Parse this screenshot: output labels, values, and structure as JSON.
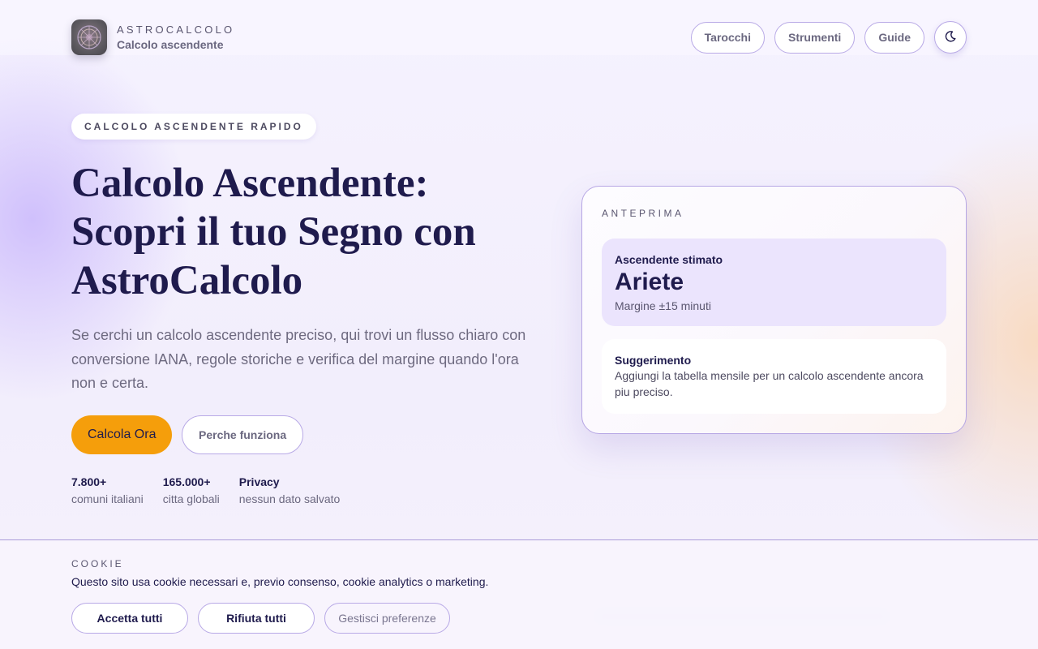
{
  "brand": {
    "name": "ASTROCALCOLO",
    "subtitle": "Calcolo ascendente",
    "logo_icon": "zodiac-wheel-icon"
  },
  "nav": {
    "items": [
      {
        "label": "Tarocchi"
      },
      {
        "label": "Strumenti"
      },
      {
        "label": "Guide"
      }
    ],
    "theme_toggle_icon": "moon-icon"
  },
  "hero": {
    "eyebrow": "CALCOLO ASCENDENTE RAPIDO",
    "title": "Calcolo Ascendente: Scopri il tuo Segno con AstroCalcolo",
    "lead": "Se cerchi un calcolo ascendente preciso, qui trovi un flusso chiaro con conversione IANA, regole storiche e verifica del margine quando l'ora non e certa.",
    "primary_cta": "Calcola Ora",
    "secondary_cta": "Perche funziona",
    "stats": [
      {
        "value": "7.800+",
        "label": "comuni italiani"
      },
      {
        "value": "165.000+",
        "label": "citta globali"
      },
      {
        "value": "Privacy",
        "label": "nessun dato salvato"
      }
    ]
  },
  "preview": {
    "eyebrow": "ANTEPRIMA",
    "result_label": "Ascendente stimato",
    "result_value": "Ariete",
    "result_note": "Margine ±15 minuti",
    "tip_title": "Suggerimento",
    "tip_text": "Aggiungi la tabella mensile per un calcolo ascendente ancora piu preciso."
  },
  "cookie": {
    "eyebrow": "COOKIE",
    "text": "Questo sito usa cookie necessari e, previo consenso, cookie analytics o marketing.",
    "accept": "Accetta tutti",
    "reject": "Rifiuta tutti",
    "manage": "Gestisci preferenze"
  },
  "colors": {
    "accent": "#f59e0b",
    "ink": "#1f1b4d",
    "border": "#b8a9e6",
    "result_bg": "#ebe4fd"
  }
}
